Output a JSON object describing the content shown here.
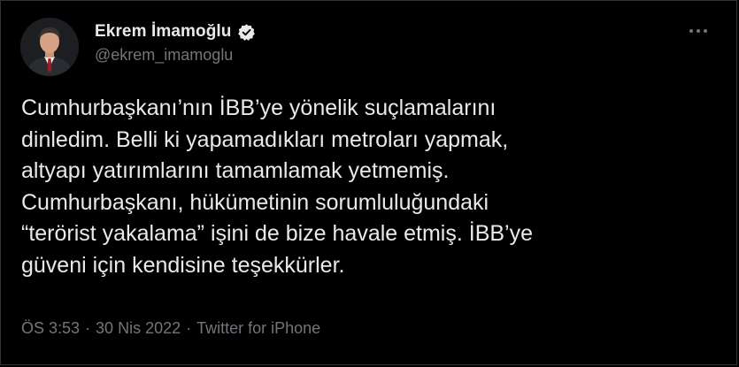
{
  "author": {
    "display_name": "Ekrem İmamoğlu",
    "handle": "@ekrem_imamoglu",
    "verified": true
  },
  "tweet": {
    "text": "Cumhurbaşkanı’nın İBB’ye yönelik suçlamalarını\ndinledim. Belli ki yapamadıkları metroları yapmak,\naltyapı yatırımlarını tamamlamak yetmemiş.\nCumhurbaşkanı, hükümetinin sorumluluğundaki\n“terörist yakalama” işini de bize havale etmiş. İBB’ye\ngüveni için kendisine teşekkürler."
  },
  "meta": {
    "time": "ÖS 3:53",
    "separator": "·",
    "date": "30 Nis 2022",
    "source": "Twitter for iPhone"
  },
  "icons": {
    "more": "more-icon",
    "verified": "verified-badge-icon"
  },
  "colors": {
    "background": "#000000",
    "text_primary": "#e7e9ea",
    "text_secondary": "#71767b",
    "verified_badge": "#e7e9ea"
  }
}
